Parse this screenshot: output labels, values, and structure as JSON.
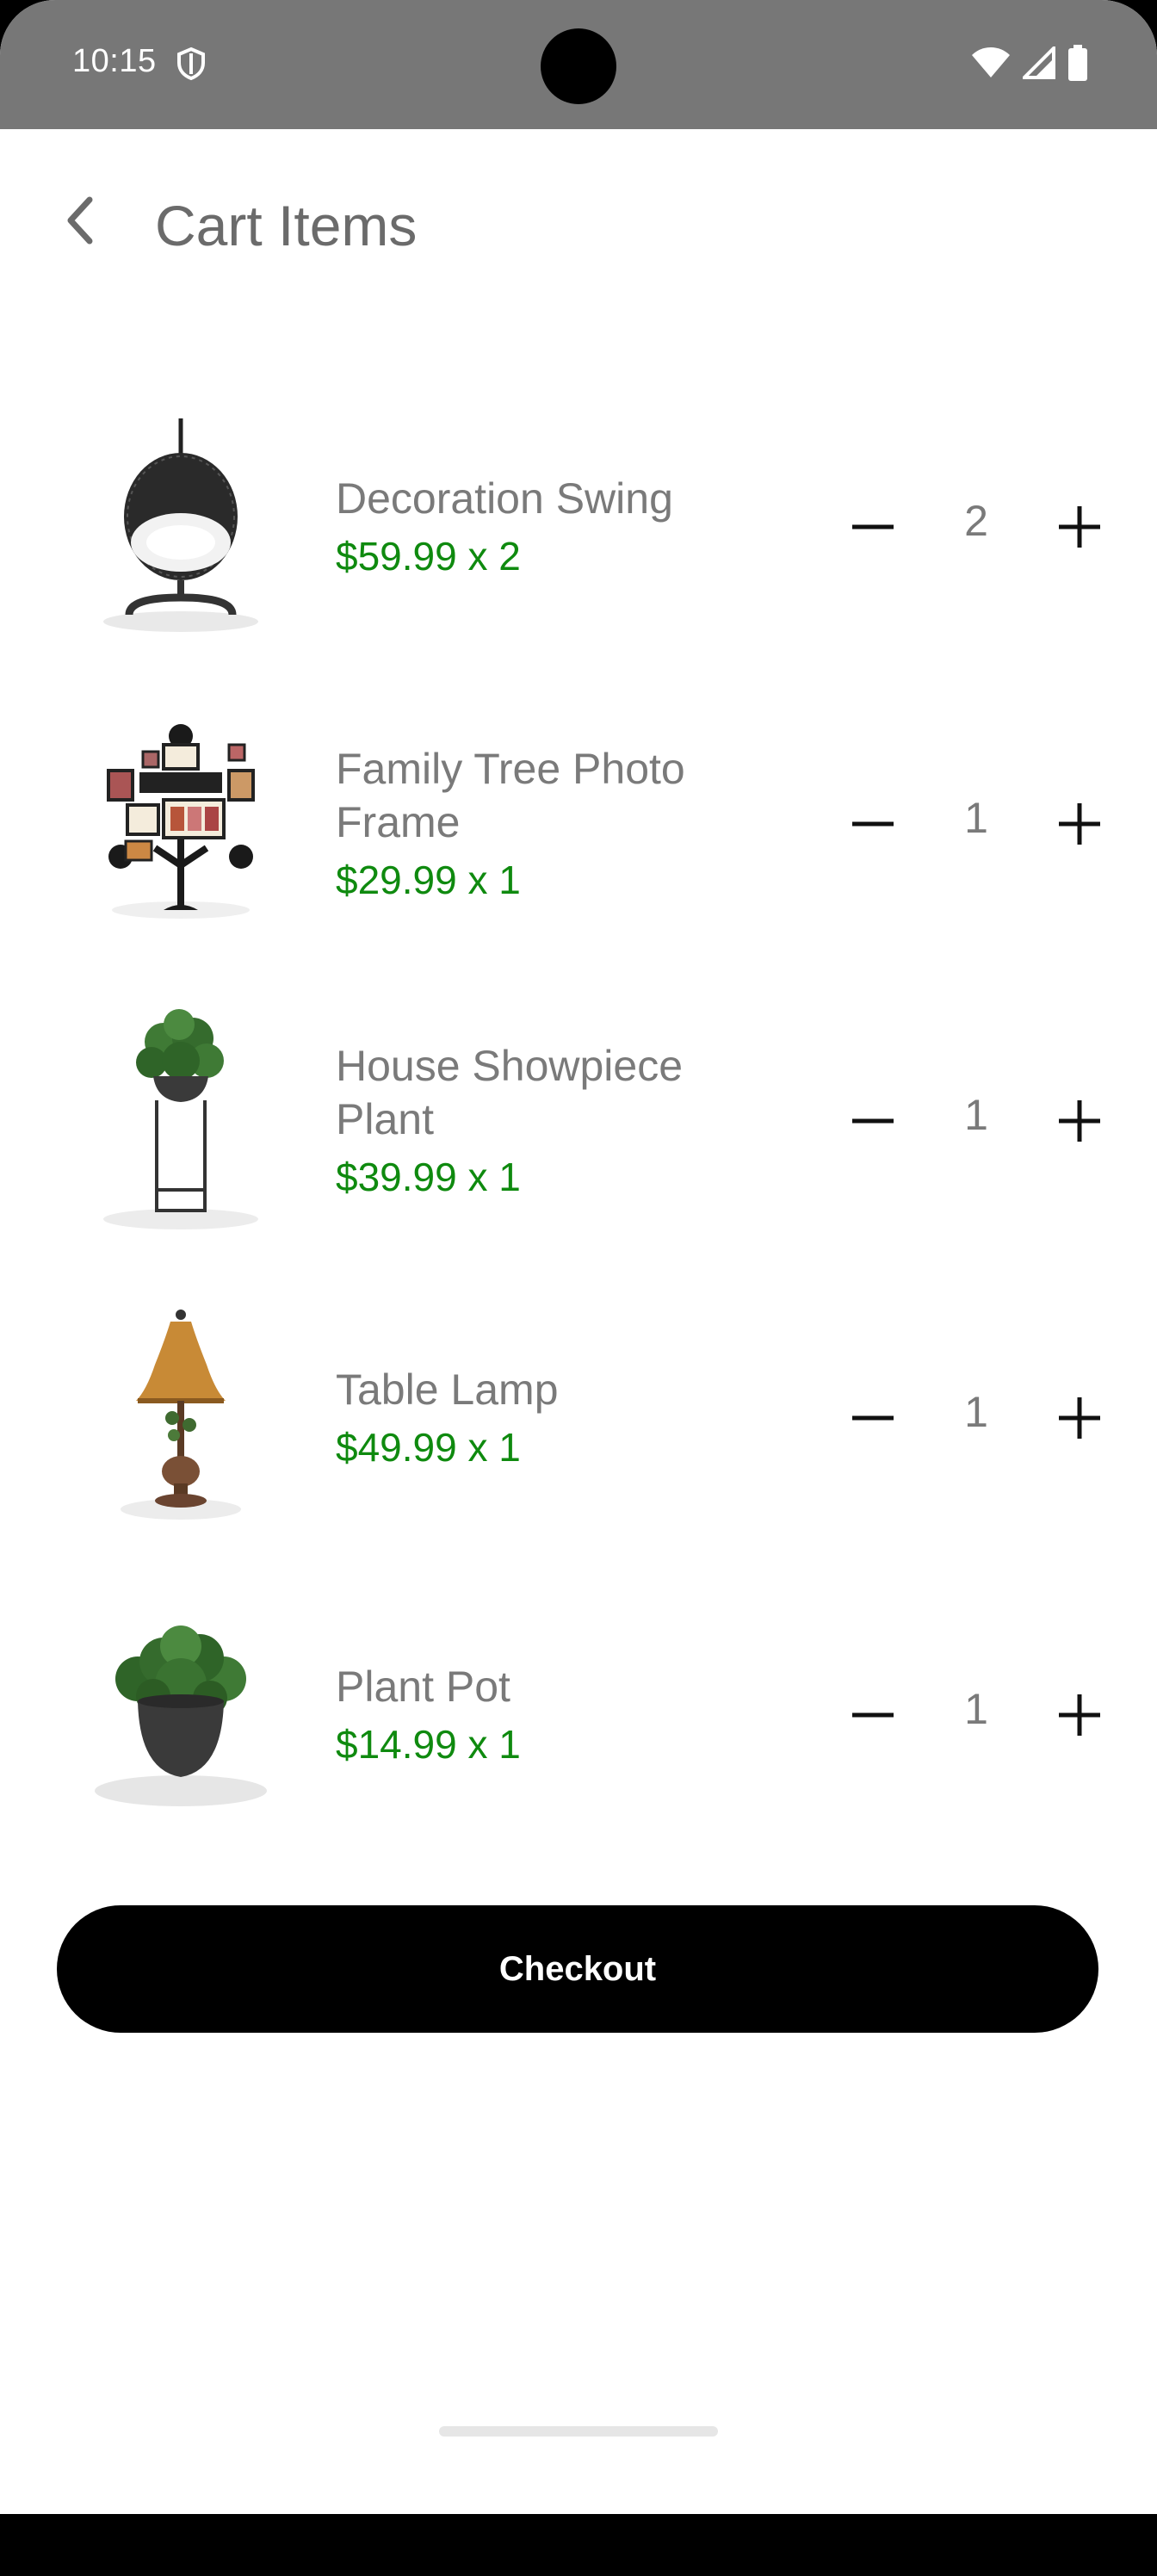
{
  "status_bar": {
    "time": "10:15"
  },
  "header": {
    "title": "Cart Items"
  },
  "items": [
    {
      "name": "Decoration Swing",
      "price_line": "$59.99 x 2",
      "quantity": "2",
      "image": "decoration-swing"
    },
    {
      "name": "Family Tree Photo Frame",
      "price_line": "$29.99 x 1",
      "quantity": "1",
      "image": "family-tree-frame"
    },
    {
      "name": "House Showpiece Plant",
      "price_line": "$39.99 x 1",
      "quantity": "1",
      "image": "showpiece-plant"
    },
    {
      "name": "Table Lamp",
      "price_line": "$49.99 x 1",
      "quantity": "1",
      "image": "table-lamp"
    },
    {
      "name": "Plant Pot",
      "price_line": "$14.99 x 1",
      "quantity": "1",
      "image": "plant-pot"
    }
  ],
  "checkout": {
    "label": "Checkout"
  },
  "colors": {
    "price": "#0f8a0f",
    "title": "#6b6b6b",
    "status_bar": "#777777",
    "button": "#000000"
  }
}
